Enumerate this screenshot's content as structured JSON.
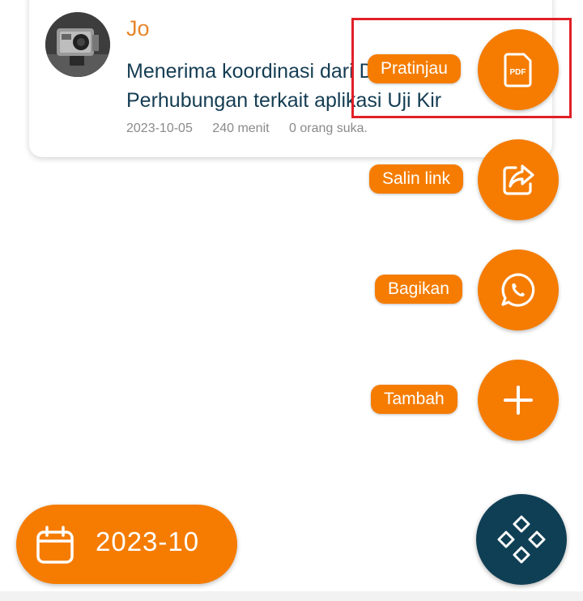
{
  "card": {
    "author": "Jo",
    "message_line1": "Menerima koordinasi dari Dinas",
    "message_line2": "Perhubungan terkait aplikasi Uji Kir",
    "date": "2023-10-05",
    "duration": "240 menit",
    "likes": "0 orang suka."
  },
  "actions": [
    {
      "label": "Pratinjau",
      "icon": "pdf-icon",
      "icon_text": "PDF"
    },
    {
      "label": "Salin link",
      "icon": "share-icon"
    },
    {
      "label": "Bagikan",
      "icon": "whatsapp-icon"
    },
    {
      "label": "Tambah",
      "icon": "plus-icon"
    }
  ],
  "date_filter": {
    "label": "2023-10",
    "icon": "calendar-icon"
  },
  "menu_button": {
    "icon": "diamond-grid-icon"
  },
  "colors": {
    "accent": "#f57c00",
    "dark": "#0f3f55",
    "text": "#143d53",
    "highlight": "#e02027"
  }
}
